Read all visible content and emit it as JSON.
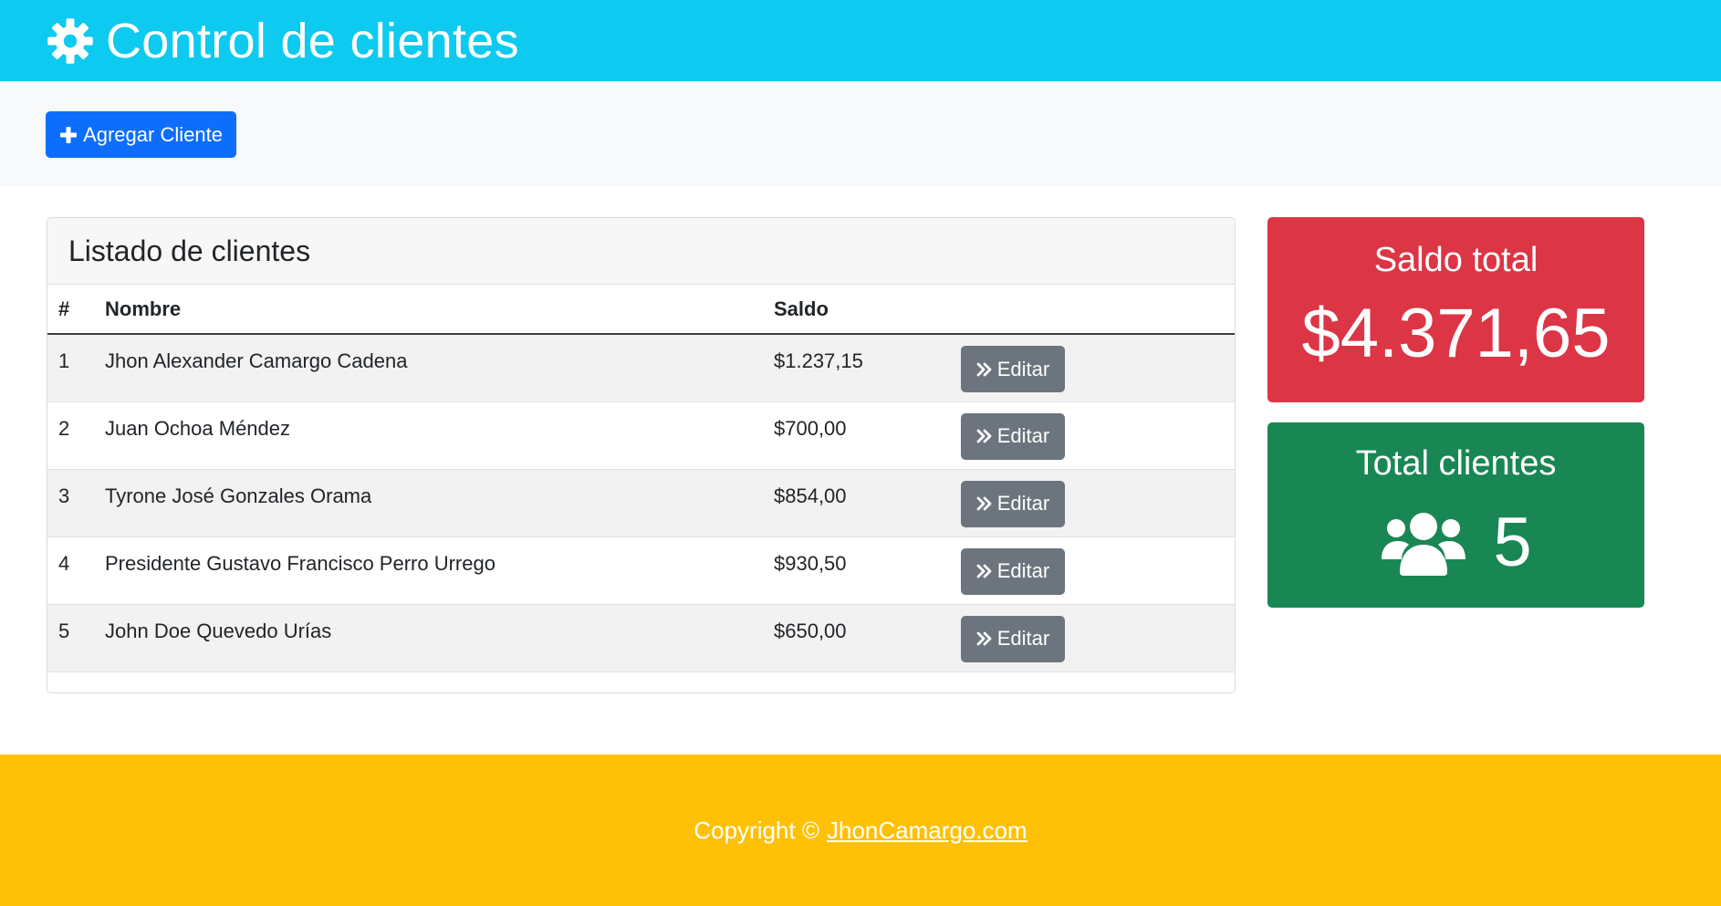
{
  "header": {
    "title": "Control de clientes",
    "icon": "gear-icon"
  },
  "actions": {
    "add_label": "Agregar Cliente",
    "add_icon": "plus-icon"
  },
  "clients_card": {
    "title": "Listado de clientes",
    "columns": [
      "#",
      "Nombre",
      "Saldo",
      ""
    ],
    "rows": [
      {
        "num": "1",
        "name": "Jhon Alexander Camargo Cadena",
        "saldo": "$1.237,15",
        "action": "Editar"
      },
      {
        "num": "2",
        "name": "Juan Ochoa Méndez",
        "saldo": "$700,00",
        "action": "Editar"
      },
      {
        "num": "3",
        "name": "Tyrone José Gonzales Orama",
        "saldo": "$854,00",
        "action": "Editar"
      },
      {
        "num": "4",
        "name": "Presidente Gustavo Francisco Perro Urrego",
        "saldo": "$930,50",
        "action": "Editar"
      },
      {
        "num": "5",
        "name": "John Doe Quevedo Urías",
        "saldo": "$650,00",
        "action": "Editar"
      }
    ]
  },
  "stats": {
    "saldo_title": "Saldo total",
    "saldo_value": "$4.371,65",
    "clientes_title": "Total clientes",
    "clientes_value": "5",
    "clientes_icon": "users-icon"
  },
  "footer": {
    "copyright": "Copyright ©",
    "link_text": "JhonCamargo.com"
  },
  "colors": {
    "header": "#0dcaf0",
    "primary": "#0d6efd",
    "secondary": "#6c757d",
    "danger": "#dc3545",
    "success": "#198754",
    "footer": "#ffc107"
  }
}
